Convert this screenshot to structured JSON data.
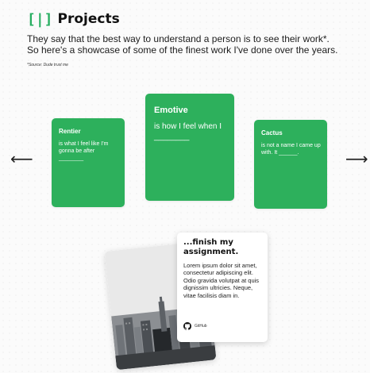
{
  "header": {
    "icon_glyph": "[|]",
    "icon_name": "brackets-icon",
    "title": "Projects",
    "intro_line1": "They say that the best way to understand a person is to see their work*.",
    "intro_line2": "So here's a showcase of some of the finest work I've done over the years.",
    "footnote": "*Source: Dude trust me"
  },
  "colors": {
    "accent": "#27ae60",
    "card_green": "#2db05c",
    "background": "#fbfbfb"
  },
  "carousel": {
    "prev_arrow": "⟵",
    "next_arrow": "⟶",
    "cards": [
      {
        "title": "Rentier",
        "description": "is what I feel like I'm gonna be after ________"
      },
      {
        "title": "Emotive",
        "description": "is how I feel when I ________"
      },
      {
        "title": "Cactus",
        "description": "is not a name I came up with. It ______."
      }
    ]
  },
  "feature": {
    "title": "...finish my assignment.",
    "body": "Lorem ipsum dolor sit amet, consectetur adipiscing elit. Odio gravida volutpat at quis dignissim ultricies. Neque, vitae facilisis diam in.",
    "link_label": "GitHub",
    "link_icon": "github-icon",
    "photo_subject": "city-skyline"
  }
}
